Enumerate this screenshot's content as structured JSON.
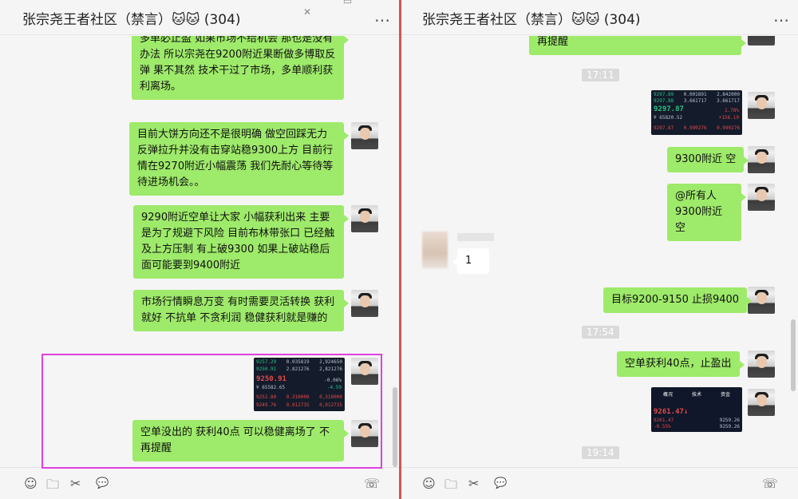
{
  "left": {
    "title": "张宗尧王者社区（禁言）🐱🐱 (304)",
    "more": "…",
    "messages": [
      "多单必止盈 如果市场不给机会 那也是没有办法 所以宗尧在9200附近果断做多博取反弹 果不其然 技术干过了市场，多单顺利获利离场。",
      "目前大饼方向还不是很明确 做空回踩无力反弹拉升并没有击穿站稳9300上方 目前行情在9270附近小幅震荡 我们先耐心等待等待进场机会。。",
      "9290附近空单让大家 小幅获利出来 主要是为了规避下风险  目前布林带张口 已经触及上方压制 有上破9300 如果上破站稳后面可能要到9400附近",
      "市场行情瞬息万变  有时需要灵活转换  获利就好 不抗单 不贪利润  稳健获利就是赚的",
      "空单没出的 获利40点 可以稳健离场了  不再提醒"
    ],
    "chart": {
      "r1": [
        "9257.29",
        "0.035819",
        "2,924650"
      ],
      "r2": [
        "9250.91",
        "2.821276",
        "2,821276"
      ],
      "price": "9250.91",
      "change": "-0.06%",
      "sub": "¥ 65582.65",
      "subchg": "-4.59",
      "r3": [
        "9252.80",
        "0.310000",
        "0,310000"
      ],
      "r4": [
        "9249.76",
        "0.012735",
        "0,012735"
      ]
    }
  },
  "right": {
    "title": "张宗尧王者社区（禁言）🐱🐱 (304)",
    "more": "…",
    "top_bubble": "再提醒",
    "time1": "17:11",
    "chart1": {
      "r1": [
        "9297.89",
        "0.001891",
        "2.842000"
      ],
      "r2": [
        "9297.88",
        "3.661717",
        "3.661717"
      ],
      "price": "9297.87",
      "change": "1.78%",
      "sub": "¥ 65820.52",
      "subchg": "+156.19",
      "r3": [
        "9297.87",
        "0.990276",
        "0.990276"
      ]
    },
    "msg1": "9300附近 空",
    "msg2a": "@所有人",
    "msg2b": "9300附近 空",
    "other_msg": "1",
    "msg3": "目标9200-9150 止损9400",
    "time2": "17:54",
    "msg4": "空单获利40点，止盈出",
    "chart2": {
      "tabs": [
        "概况",
        "技术",
        "资金"
      ],
      "price": "9261.47",
      "arrow": "↓",
      "r1": [
        "9261.47",
        "9259.26"
      ],
      "r2": [
        "-0.55%",
        "9259.26"
      ]
    },
    "time3": "19:14"
  },
  "footer": {
    "emoji": "☺",
    "folder": "🗀",
    "scissors": "✂",
    "chat": "💬",
    "phone": "☏"
  }
}
